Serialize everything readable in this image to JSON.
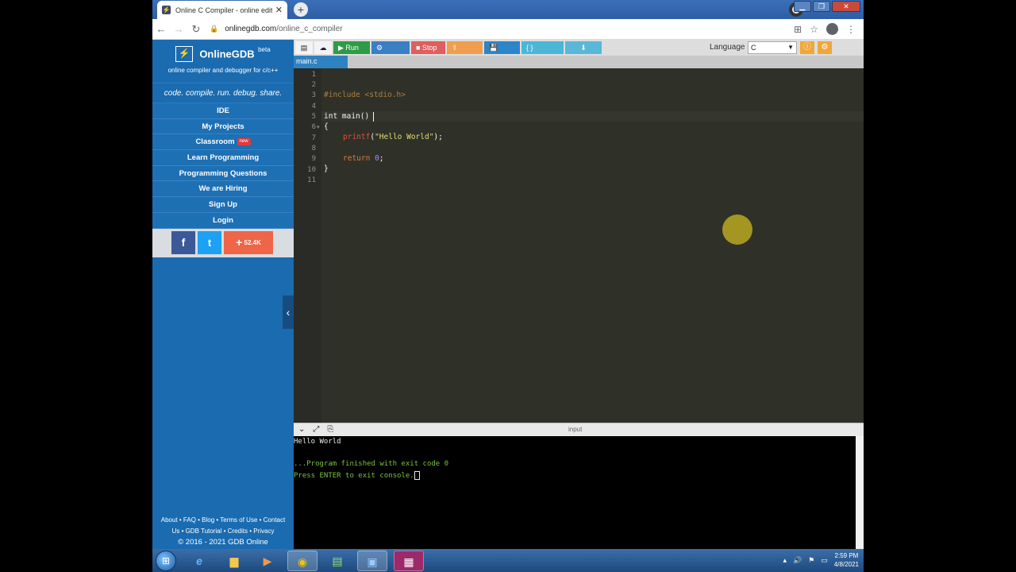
{
  "browser": {
    "tab_title": "Online C Compiler - online editor",
    "tab_close": "✕",
    "new_tab": "+",
    "url_domain": "onlinegdb.com",
    "url_path": "/online_c_compiler",
    "win_min": "▁",
    "win_max": "❐",
    "win_close": "✕"
  },
  "sidebar": {
    "brand": "OnlineGDB",
    "beta": "beta",
    "tagline": "online compiler and debugger for c/c++",
    "slogan": "code. compile. run. debug. share.",
    "nav": [
      {
        "label": "IDE"
      },
      {
        "label": "My Projects"
      },
      {
        "label": "Classroom",
        "badge": "new"
      },
      {
        "label": "Learn Programming"
      },
      {
        "label": "Programming Questions"
      },
      {
        "label": "We are Hiring"
      },
      {
        "label": "Sign Up"
      },
      {
        "label": "Login"
      }
    ],
    "social": {
      "fb": "f",
      "tw": "t",
      "share_count": "52.4K"
    },
    "footer_line1": "About • FAQ • Blog • Terms of Use • Contact",
    "footer_line2": "Us • GDB Tutorial • Credits • Privacy",
    "copyright": "© 2016 - 2021 GDB Online"
  },
  "toolbar": {
    "run": "▶ Run",
    "debug": "⚙ Debug",
    "stop": "■ Stop",
    "share": "⇪ Share",
    "save": "💾 Save",
    "beautify": "{ } Beautify",
    "download": "⬇",
    "language_label": "Language",
    "language_value": "C"
  },
  "editor": {
    "file_tab": "main.c",
    "line_numbers": [
      "1",
      "2",
      "3",
      "4",
      "5",
      "6",
      "7",
      "8",
      "9",
      "10",
      "11"
    ],
    "lines": {
      "l3": "#include <stdio.h>",
      "l5": "int main()",
      "l6": "{",
      "l7_fn": "printf",
      "l7_open": "(",
      "l7_str": "\"Hello World\"",
      "l7_close": ");",
      "l9_kw": "return",
      "l9_num": "0",
      "l9_end": ";",
      "l10": "}"
    }
  },
  "console": {
    "header_label": "input",
    "output": "Hello World",
    "finished": "...Program finished with exit code 0",
    "press_enter": "Press ENTER to exit console."
  },
  "taskbar": {
    "time": "2:59 PM",
    "date": "4/8/2021"
  },
  "colors": {
    "sidebar_bg": "#1a6bb0",
    "editor_bg": "#2f3129",
    "console_green": "#7bc242"
  }
}
